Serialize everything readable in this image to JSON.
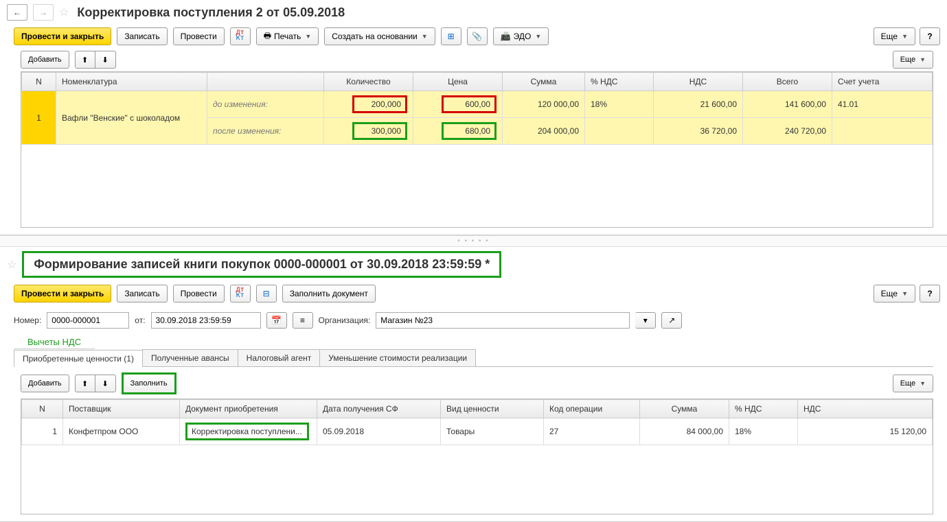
{
  "top": {
    "title": "Корректировка поступления 2 от 05.09.2018",
    "toolbar": {
      "post_close": "Провести и закрыть",
      "save": "Записать",
      "post": "Провести",
      "print": "Печать",
      "create_based": "Создать на основании",
      "edo": "ЭДО",
      "more": "Еще"
    },
    "subtoolbar": {
      "add": "Добавить",
      "more": "Еще"
    },
    "table": {
      "headers": {
        "n": "N",
        "nomen": "Номенклатура",
        "label": "",
        "qty": "Количество",
        "price": "Цена",
        "sum": "Сумма",
        "vat_pct": "% НДС",
        "vat": "НДС",
        "total": "Всего",
        "account": "Счет учета"
      },
      "row": {
        "n": "1",
        "nomen": "Вафли \"Венские\" с шоколадом",
        "before_label": "до изменения:",
        "after_label": "после изменения:",
        "before": {
          "qty": "200,000",
          "price": "600,00",
          "sum": "120 000,00",
          "vat_pct": "18%",
          "vat": "21 600,00",
          "total": "141 600,00",
          "account": "41.01"
        },
        "after": {
          "qty": "300,000",
          "price": "680,00",
          "sum": "204 000,00",
          "vat_pct": "",
          "vat": "36 720,00",
          "total": "240 720,00",
          "account": ""
        }
      }
    }
  },
  "bottom": {
    "title": "Формирование записей книги покупок 0000-000001 от 30.09.2018 23:59:59 *",
    "toolbar": {
      "post_close": "Провести и закрыть",
      "save": "Записать",
      "post": "Провести",
      "fill_doc": "Заполнить документ",
      "more": "Еще"
    },
    "form": {
      "number_label": "Номер:",
      "number": "0000-000001",
      "date_label": "от:",
      "date": "30.09.2018 23:59:59",
      "org_label": "Организация:",
      "org": "Магазин №23"
    },
    "section": "Вычеты НДС",
    "tabs": {
      "t1": "Приобретенные ценности (1)",
      "t2": "Полученные авансы",
      "t3": "Налоговый агент",
      "t4": "Уменьшение стоимости реализации"
    },
    "subtoolbar": {
      "add": "Добавить",
      "fill": "Заполнить",
      "more": "Еще"
    },
    "table": {
      "headers": {
        "n": "N",
        "supplier": "Поставщик",
        "doc": "Документ приобретения",
        "sf_date": "Дата получения СФ",
        "kind": "Вид ценности",
        "opcode": "Код операции",
        "sum": "Сумма",
        "vat_pct": "% НДС",
        "vat": "НДС"
      },
      "row": {
        "n": "1",
        "supplier": "Конфетпром ООО",
        "doc": "Корректировка поступлени...",
        "sf_date": "05.09.2018",
        "kind": "Товары",
        "opcode": "27",
        "sum": "84 000,00",
        "vat_pct": "18%",
        "vat": "15 120,00"
      }
    }
  },
  "help": "?"
}
